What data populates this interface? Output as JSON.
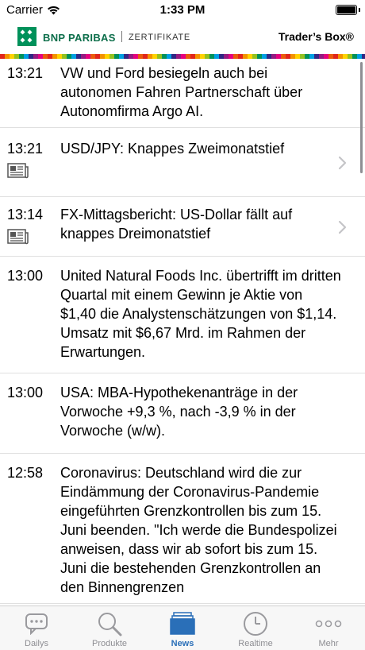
{
  "status_bar": {
    "carrier": "Carrier",
    "time": "1:33 PM"
  },
  "header": {
    "bank_name": "BNP PARIBAS",
    "division": "ZERTIFIKATE",
    "app_name": "Trader’s Box®",
    "brand_color": "#00915A"
  },
  "news": [
    {
      "time": "13:21",
      "title": "VW und Ford besiegeln auch bei autonomen Fahren Partnerschaft über Autonomfirma Argo AI.",
      "has_icon": false,
      "has_chevron": false
    },
    {
      "time": "13:21",
      "title": "USD/JPY: Knappes Zweimonatstief",
      "has_icon": true,
      "has_chevron": true
    },
    {
      "time": "13:14",
      "title": "FX-Mittagsbericht: US-Dollar fällt auf knappes Dreimonatstief",
      "has_icon": true,
      "has_chevron": true
    },
    {
      "time": "13:00",
      "title": "United Natural Foods Inc. übertrifft im dritten Quartal mit einem Gewinn je Aktie von $1,40 die Analystenschätzungen von $1,14. Umsatz mit $6,67 Mrd. im Rahmen der Erwartungen.",
      "has_icon": false,
      "has_chevron": false
    },
    {
      "time": "13:00",
      "title": "USA: MBA-Hypothekenanträge in der Vorwoche +9,3 %, nach -3,9 % in der Vorwoche (w/w).",
      "has_icon": false,
      "has_chevron": false
    },
    {
      "time": "12:58",
      "title": "Coronavirus: Deutschland wird die zur Eindämmung der Coronavirus-Pandemie eingeführten Grenzkontrollen bis zum 15. Juni beenden. \"Ich werde die Bundespolizei anweisen, dass wir ab sofort bis zum 15. Juni die bestehenden Grenzkontrollen an den Binnengrenzen",
      "has_icon": false,
      "has_chevron": false
    }
  ],
  "tabs": [
    {
      "label": "Dailys",
      "icon": "chat-bubble-icon",
      "active": false
    },
    {
      "label": "Produkte",
      "icon": "search-icon",
      "active": false
    },
    {
      "label": "News",
      "icon": "news-stack-icon",
      "active": true
    },
    {
      "label": "Realtime",
      "icon": "clock-icon",
      "active": false
    },
    {
      "label": "Mehr",
      "icon": "more-dots-icon",
      "active": false
    }
  ],
  "colors": {
    "active_tab": "#2a6fb8",
    "inactive_tab": "#8e8e93"
  }
}
